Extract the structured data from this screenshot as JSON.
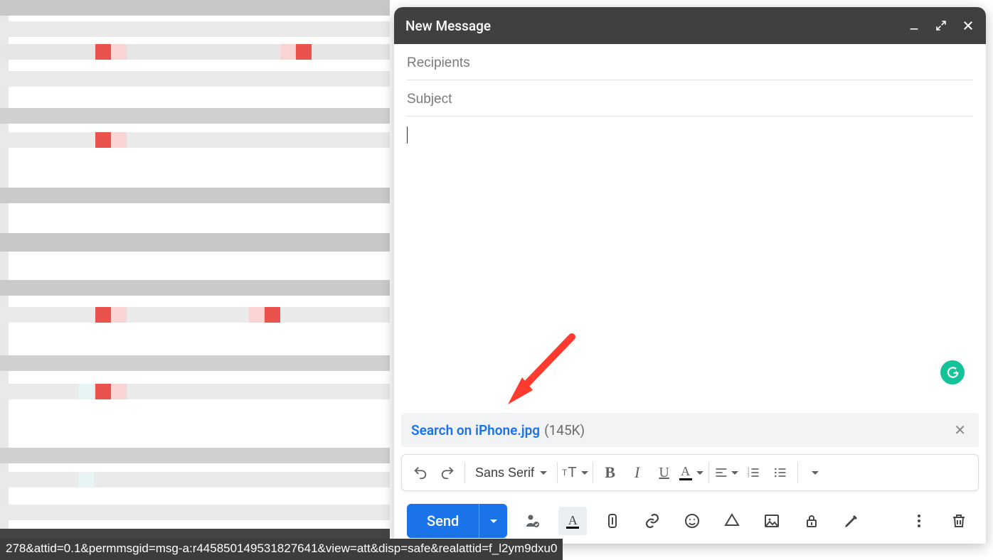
{
  "compose": {
    "title": "New Message",
    "recipients_placeholder": "Recipients",
    "subject_placeholder": "Subject",
    "send_label": "Send",
    "font_name": "Sans Serif"
  },
  "attachment": {
    "name": "Search on iPhone.jpg",
    "size": "(145K)"
  },
  "status_bar": "278&attid=0.1&permmsgid=msg-a:r445850149531827641&view=att&disp=safe&realattid=f_l2ym9dxu0"
}
